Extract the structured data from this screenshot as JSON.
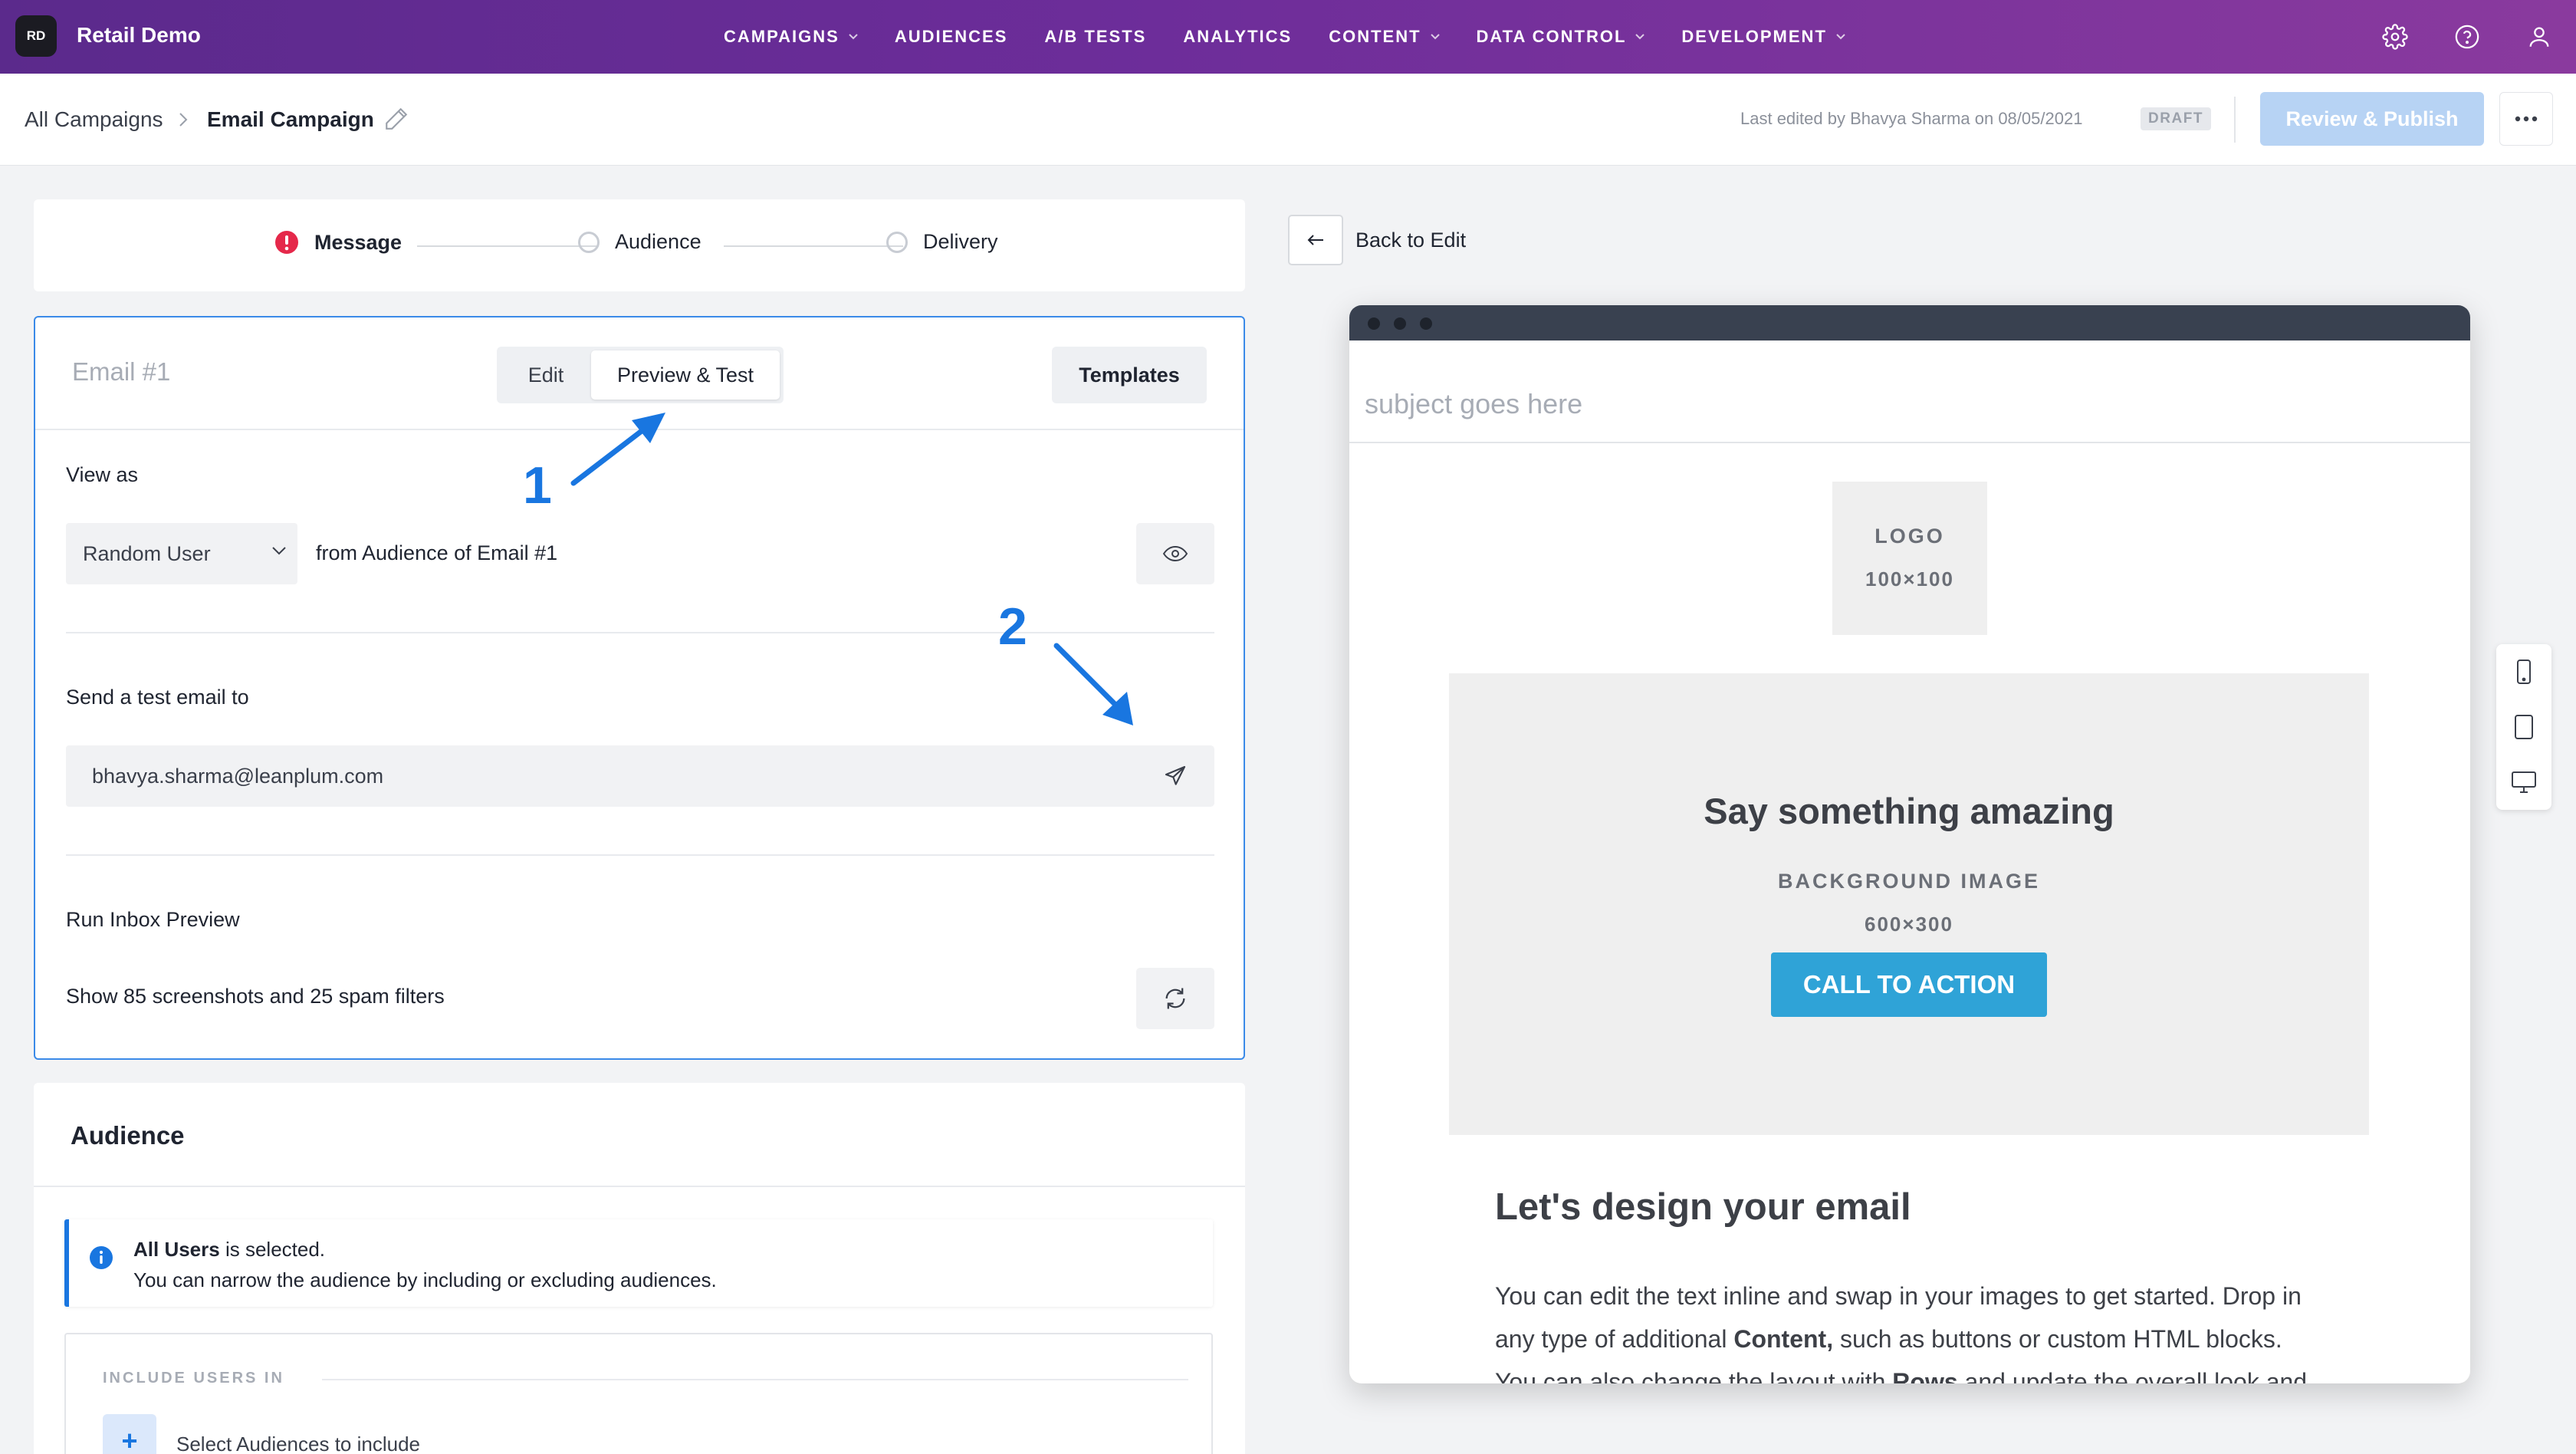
{
  "app": {
    "badge": "RD",
    "name": "Retail Demo"
  },
  "nav": [
    {
      "label": "CAMPAIGNS",
      "has_menu": true
    },
    {
      "label": "AUDIENCES",
      "has_menu": false
    },
    {
      "label": "A/B TESTS",
      "has_menu": false
    },
    {
      "label": "ANALYTICS",
      "has_menu": false
    },
    {
      "label": "CONTENT",
      "has_menu": true
    },
    {
      "label": "DATA CONTROL",
      "has_menu": true
    },
    {
      "label": "DEVELOPMENT",
      "has_menu": true
    }
  ],
  "top_icons": [
    "settings-gear-icon",
    "help-icon",
    "user-icon"
  ],
  "breadcrumb": {
    "root": "All Campaigns",
    "current": "Email Campaign"
  },
  "header": {
    "last_edited": "Last edited by Bhavya Sharma on 08/05/2021",
    "status": "DRAFT",
    "publish_label": "Review & Publish"
  },
  "stepper": {
    "steps": [
      "Message",
      "Audience",
      "Delivery"
    ],
    "active_step_state": "error"
  },
  "email_card": {
    "title": "Email #1",
    "mode_edit": "Edit",
    "mode_preview": "Preview & Test",
    "selected_mode": "Preview & Test",
    "templates_label": "Templates",
    "view_as_label": "View as",
    "view_as_value": "Random User",
    "view_as_suffix": "from Audience of Email #1",
    "send_test_label": "Send a test email to",
    "test_email_value": "bhavya.sharma@leanplum.com",
    "inbox_preview_label": "Run Inbox Preview",
    "inbox_preview_desc": "Show 85 screenshots and 25 spam filters"
  },
  "annotations": [
    "1",
    "2"
  ],
  "audience": {
    "title": "Audience",
    "info_strong": "All Users",
    "info_rest": " is selected.",
    "info_line2": "You can narrow the audience by including or excluding audiences.",
    "include_label": "INCLUDE USERS IN",
    "include_placeholder": "Select Audiences to include"
  },
  "preview": {
    "back_label": "Back to Edit",
    "subject": "subject goes here",
    "logo_label": "LOGO",
    "logo_size": "100×100",
    "hero_title": "Say something amazing",
    "hero_bg": "BACKGROUND IMAGE",
    "hero_size": "600×300",
    "cta": "CALL TO ACTION",
    "design_title": "Let's design your email",
    "body_1": "You can edit the text inline and swap in your images to get started. Drop in",
    "body_2_pre": "any type of additional ",
    "body_2_strong": "Content,",
    "body_2_post": " such as buttons or custom HTML blocks.",
    "body_3_pre": "You can also change the layout with ",
    "body_3_strong": "Rows",
    "body_3_post": " and update the overall look and"
  },
  "device_switcher": [
    "mobile-icon",
    "tablet-icon",
    "desktop-icon"
  ],
  "colors": {
    "brand_gradient_start": "#5b2a8c",
    "brand_gradient_end": "#8a3a9e",
    "accent": "#1976e0",
    "cta": "#2fa3d7",
    "error": "#e5284a"
  }
}
